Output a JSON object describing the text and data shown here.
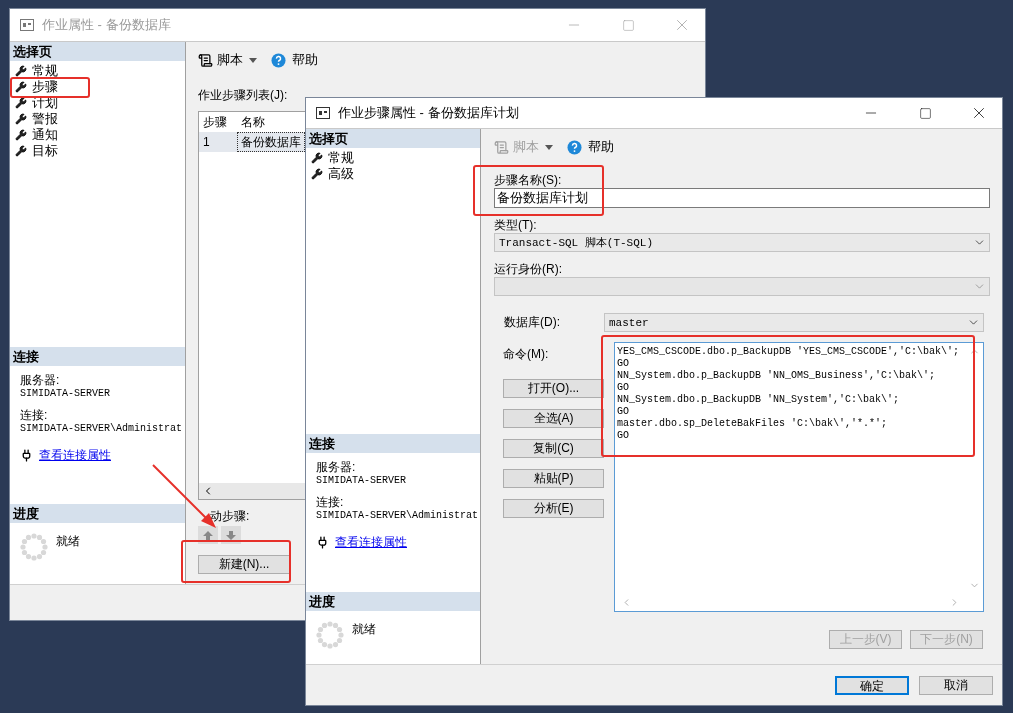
{
  "back_window": {
    "title": "作业属性 - 备份数据库",
    "select_page": {
      "header": "选择页",
      "pages": [
        "常规",
        "步骤",
        "计划",
        "警报",
        "通知",
        "目标"
      ]
    },
    "toolbar": {
      "script": "脚本",
      "script_disabled": false,
      "help": "帮助"
    },
    "steps_list_label": "作业步骤列表(J):",
    "table": {
      "columns": [
        "步骤",
        "名称"
      ],
      "rows": [
        {
          "cells": [
            "1",
            "备份数据库"
          ],
          "selected": true
        }
      ]
    },
    "move_steps_label": "动步骤:",
    "new_button": "新建(N)...",
    "connection": {
      "header": "连接",
      "server_label": "服务器:",
      "server": "SIMIDATA-SERVER",
      "connection_label": "连接:",
      "connection": "SIMIDATA-SERVER\\Administrat",
      "link": "查看连接属性"
    },
    "progress": {
      "header": "进度",
      "status": "就绪"
    }
  },
  "front_window": {
    "title": "作业步骤属性 - 备份数据库计划",
    "select_page": {
      "header": "选择页",
      "pages": [
        "常规",
        "高级"
      ]
    },
    "toolbar": {
      "script": "脚本",
      "script_disabled": true,
      "help": "帮助"
    },
    "step_name": {
      "label": "步骤名称(S):",
      "value": "备份数据库计划"
    },
    "type": {
      "label": "类型(T):",
      "value": "Transact-SQL 脚本(T-SQL)"
    },
    "run_as": {
      "label": "运行身份(R):",
      "disabled": true
    },
    "database": {
      "label": "数据库(D):",
      "value": "master"
    },
    "command": {
      "label": "命令(M):",
      "lines": [
        "YES_CMS_CSCODE.dbo.p_BackupDB 'YES_CMS_CSCODE','C:\\bak\\';",
        "GO",
        "NN_System.dbo.p_BackupDB 'NN_OMS_Business','C:\\bak\\';",
        "GO",
        "NN_System.dbo.p_BackupDB 'NN_System','C:\\bak\\';",
        "GO",
        "master.dbo.sp_DeleteBakFiles 'C:\\bak\\','*.*';",
        "GO"
      ]
    },
    "command_buttons": [
      "打开(O)...",
      "全选(A)",
      "复制(C)",
      "粘贴(P)",
      "分析(E)"
    ],
    "nav_buttons": [
      {
        "label": "上一步(V)",
        "disabled": true
      },
      {
        "label": "下一步(N)",
        "disabled": true
      }
    ],
    "connection": {
      "header": "连接",
      "server_label": "服务器:",
      "server": "SIMIDATA-SERVER",
      "connection_label": "连接:",
      "connection": "SIMIDATA-SERVER\\Administrat",
      "link": "查看连接属性"
    },
    "progress": {
      "header": "进度",
      "status": "就绪"
    },
    "dialog_buttons": [
      {
        "label": "确定",
        "default": true
      },
      {
        "label": "取消",
        "default": false
      }
    ]
  }
}
